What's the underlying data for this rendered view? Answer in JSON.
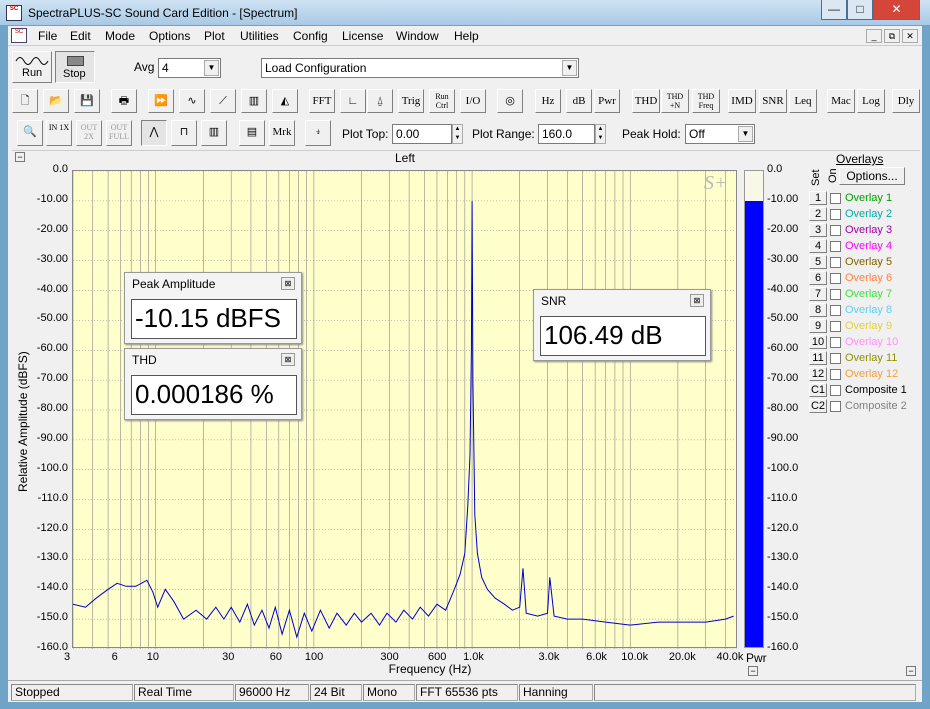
{
  "window": {
    "title": "SpectraPLUS-SC Sound Card Edition - [Spectrum]",
    "app_icon": "SC",
    "minimize": "—",
    "maximize": "□",
    "close": "✕"
  },
  "menu": [
    "File",
    "Edit",
    "Mode",
    "Options",
    "Plot",
    "Utilities",
    "Config",
    "License",
    "Window",
    "Help"
  ],
  "mdi_controls": [
    "_",
    "⧉",
    "✕"
  ],
  "toolbar1": {
    "run": "Run",
    "stop": "Stop",
    "avg_label": "Avg",
    "avg_value": "4",
    "config_value": "Load Configuration"
  },
  "toolbar2": [
    "FFT",
    "Trig",
    "Run Ctrl",
    "I/O",
    "Hz",
    "dB",
    "Pwr",
    "THD",
    "THD +N",
    "THD Freq",
    "IMD",
    "SNR",
    "Leq",
    "Mac",
    "Log",
    "Dly"
  ],
  "toolbar3": {
    "in1x": "IN 1X",
    "out2x": "OUT 2X",
    "outfull": "OUT FULL",
    "mrk": "Mrk",
    "plot_top_label": "Plot Top:",
    "plot_top_value": "0.00",
    "plot_range_label": "Plot Range:",
    "plot_range_value": "160.0",
    "peak_hold_label": "Peak Hold:",
    "peak_hold_value": "Off"
  },
  "plot": {
    "channel": "Left",
    "logo": "S+",
    "ylabel": "Relative Amplitude (dBFS)",
    "xlabel": "Frequency (Hz)",
    "pwr_label": "Pwr"
  },
  "chart_data": {
    "type": "line",
    "title": "Left",
    "xlabel": "Frequency (Hz)",
    "ylabel": "Relative Amplitude (dBFS)",
    "xscale": "log",
    "xlim": [
      3,
      48000
    ],
    "ylim": [
      -160,
      0
    ],
    "grid": true,
    "y_ticks": [
      "0.0",
      "-10.00",
      "-20.00",
      "-30.00",
      "-40.00",
      "-50.00",
      "-60.00",
      "-70.00",
      "-80.00",
      "-90.00",
      "-100.0",
      "-110.0",
      "-120.0",
      "-130.0",
      "-140.0",
      "-150.0",
      "-160.0"
    ],
    "x_ticks": [
      {
        "v": 3,
        "t": "3"
      },
      {
        "v": 6,
        "t": "6"
      },
      {
        "v": 10,
        "t": "10"
      },
      {
        "v": 30,
        "t": "30"
      },
      {
        "v": 60,
        "t": "60"
      },
      {
        "v": 100,
        "t": "100"
      },
      {
        "v": 300,
        "t": "300"
      },
      {
        "v": 600,
        "t": "600"
      },
      {
        "v": 1000,
        "t": "1.0k"
      },
      {
        "v": 3000,
        "t": "3.0k"
      },
      {
        "v": 6000,
        "t": "6.0k"
      },
      {
        "v": 10000,
        "t": "10.0k"
      },
      {
        "v": 20000,
        "t": "20.0k"
      },
      {
        "v": 40000,
        "t": "40.0k"
      }
    ],
    "series": [
      {
        "color": "#0000cc",
        "points": [
          [
            3,
            -145
          ],
          [
            3.6,
            -146
          ],
          [
            4.2,
            -143
          ],
          [
            5,
            -140
          ],
          [
            5.7,
            -138
          ],
          [
            6.5,
            -139
          ],
          [
            7.5,
            -139
          ],
          [
            8.8,
            -137
          ],
          [
            9.6,
            -141
          ],
          [
            10.3,
            -146
          ],
          [
            11.5,
            -140
          ],
          [
            13,
            -144
          ],
          [
            15,
            -150
          ],
          [
            18,
            -147
          ],
          [
            21,
            -150
          ],
          [
            24,
            -146
          ],
          [
            27,
            -150
          ],
          [
            30,
            -146
          ],
          [
            34,
            -151
          ],
          [
            38,
            -145
          ],
          [
            42,
            -152
          ],
          [
            47,
            -147
          ],
          [
            52,
            -153
          ],
          [
            57,
            -146
          ],
          [
            63,
            -155
          ],
          [
            70,
            -147
          ],
          [
            78,
            -156
          ],
          [
            87,
            -148
          ],
          [
            97,
            -154
          ],
          [
            110,
            -147
          ],
          [
            125,
            -153
          ],
          [
            140,
            -148
          ],
          [
            160,
            -152
          ],
          [
            180,
            -148
          ],
          [
            200,
            -151
          ],
          [
            230,
            -148
          ],
          [
            260,
            -152
          ],
          [
            290,
            -148
          ],
          [
            330,
            -151
          ],
          [
            370,
            -147
          ],
          [
            420,
            -150
          ],
          [
            470,
            -146
          ],
          [
            530,
            -149
          ],
          [
            600,
            -145
          ],
          [
            680,
            -147
          ],
          [
            760,
            -141
          ],
          [
            840,
            -135
          ],
          [
            900,
            -128
          ],
          [
            940,
            -112
          ],
          [
            970,
            -95
          ],
          [
            990,
            -60
          ],
          [
            1000,
            -10.15
          ],
          [
            1012,
            -70
          ],
          [
            1040,
            -115
          ],
          [
            1080,
            -128
          ],
          [
            1150,
            -136
          ],
          [
            1250,
            -140
          ],
          [
            1400,
            -143
          ],
          [
            1600,
            -145
          ],
          [
            1800,
            -147
          ],
          [
            2000,
            -146
          ],
          [
            2100,
            -133
          ],
          [
            2200,
            -148
          ],
          [
            2600,
            -149
          ],
          [
            3000,
            -148
          ],
          [
            3100,
            -136
          ],
          [
            3300,
            -149
          ],
          [
            4000,
            -150
          ],
          [
            5000,
            -150
          ],
          [
            7000,
            -151
          ],
          [
            10000,
            -152
          ],
          [
            15000,
            -151
          ],
          [
            20000,
            -151
          ],
          [
            30000,
            -151
          ],
          [
            40000,
            -150
          ],
          [
            45000,
            -149
          ]
        ]
      }
    ]
  },
  "meter": {
    "level_db": -10.15,
    "range": [
      -160,
      0
    ],
    "color": "#0000ff"
  },
  "readouts": [
    {
      "title": "Peak Amplitude",
      "value": "-10.15 dBFS",
      "close": "⊠"
    },
    {
      "title": "THD",
      "value": "0.000186 %",
      "close": "⊠"
    },
    {
      "title": "SNR",
      "value": "106.49 dB",
      "close": "⊠"
    }
  ],
  "overlays": {
    "title": "Overlays",
    "set_label": "Set",
    "on_label": "On",
    "options_button": "Options...",
    "items": [
      {
        "num": "1",
        "name": "Overlay 1",
        "color": "#00a000"
      },
      {
        "num": "2",
        "name": "Overlay 2",
        "color": "#00aaaa"
      },
      {
        "num": "3",
        "name": "Overlay 3",
        "color": "#a000a0"
      },
      {
        "num": "4",
        "name": "Overlay 4",
        "color": "#ff00ff"
      },
      {
        "num": "5",
        "name": "Overlay 5",
        "color": "#806000"
      },
      {
        "num": "6",
        "name": "Overlay 6",
        "color": "#ff8040"
      },
      {
        "num": "7",
        "name": "Overlay 7",
        "color": "#40e040"
      },
      {
        "num": "8",
        "name": "Overlay 8",
        "color": "#60d0f0"
      },
      {
        "num": "9",
        "name": "Overlay 9",
        "color": "#e0d040"
      },
      {
        "num": "10",
        "name": "Overlay 10",
        "color": "#ff90ff"
      },
      {
        "num": "11",
        "name": "Overlay 11",
        "color": "#909000"
      },
      {
        "num": "12",
        "name": "Overlay 12",
        "color": "#f0a040"
      },
      {
        "num": "C1",
        "name": "Composite 1",
        "color": "#000000"
      },
      {
        "num": "C2",
        "name": "Composite 2",
        "color": "#808080"
      }
    ]
  },
  "status": [
    "Stopped",
    "Real Time",
    "96000 Hz",
    "24 Bit",
    "Mono",
    "FFT 65536 pts",
    "Hanning"
  ]
}
